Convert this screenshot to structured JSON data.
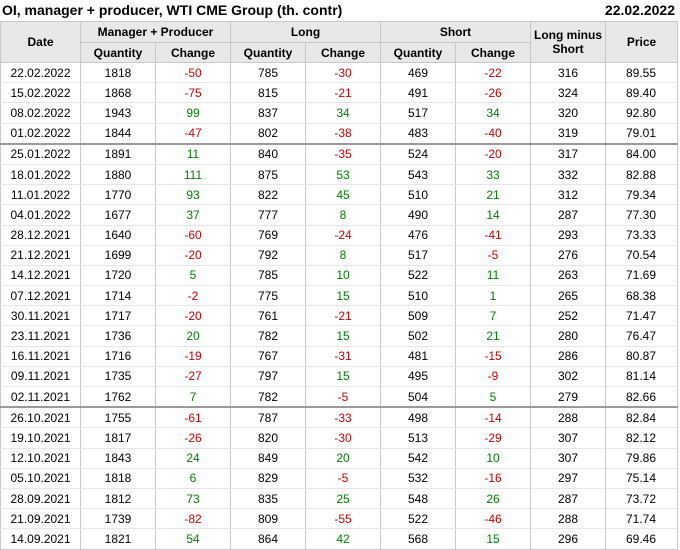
{
  "header": {
    "title": "OI, manager + producer, WTI CME Group (th. contr)",
    "date": "22.02.2022"
  },
  "columns": {
    "date": "Date",
    "manager_producer": "Manager + Producer",
    "long": "Long",
    "short": "Short",
    "long_minus_short_line1": "Long minus",
    "long_minus_short_line2": "Short",
    "price": "Price",
    "quantity": "Quantity",
    "change": "Change"
  },
  "colors": {
    "negative": "#cc0000",
    "positive": "#008000",
    "header_bg": "#e8e8e8"
  },
  "rows": [
    {
      "date": "22.02.2022",
      "mp_qty": "1818",
      "mp_chg": "-50",
      "long_qty": "785",
      "long_chg": "-30",
      "short_qty": "469",
      "short_chg": "-22",
      "lms": "316",
      "price": "89.55"
    },
    {
      "date": "15.02.2022",
      "mp_qty": "1868",
      "mp_chg": "-75",
      "long_qty": "815",
      "long_chg": "-21",
      "short_qty": "491",
      "short_chg": "-26",
      "lms": "324",
      "price": "89.40"
    },
    {
      "date": "08.02.2022",
      "mp_qty": "1943",
      "mp_chg": "99",
      "long_qty": "837",
      "long_chg": "34",
      "short_qty": "517",
      "short_chg": "34",
      "lms": "320",
      "price": "92.80"
    },
    {
      "date": "01.02.2022",
      "mp_qty": "1844",
      "mp_chg": "-47",
      "long_qty": "802",
      "long_chg": "-38",
      "short_qty": "483",
      "short_chg": "-40",
      "lms": "319",
      "price": "79.01"
    },
    {
      "date": "25.01.2022",
      "mp_qty": "1891",
      "mp_chg": "11",
      "long_qty": "840",
      "long_chg": "-35",
      "short_qty": "524",
      "short_chg": "-20",
      "lms": "317",
      "price": "84.00"
    },
    {
      "date": "18.01.2022",
      "mp_qty": "1880",
      "mp_chg": "111",
      "long_qty": "875",
      "long_chg": "53",
      "short_qty": "543",
      "short_chg": "33",
      "lms": "332",
      "price": "82.88"
    },
    {
      "date": "11.01.2022",
      "mp_qty": "1770",
      "mp_chg": "93",
      "long_qty": "822",
      "long_chg": "45",
      "short_qty": "510",
      "short_chg": "21",
      "lms": "312",
      "price": "79.34"
    },
    {
      "date": "04.01.2022",
      "mp_qty": "1677",
      "mp_chg": "37",
      "long_qty": "777",
      "long_chg": "8",
      "short_qty": "490",
      "short_chg": "14",
      "lms": "287",
      "price": "77.30"
    },
    {
      "date": "28.12.2021",
      "mp_qty": "1640",
      "mp_chg": "-60",
      "long_qty": "769",
      "long_chg": "-24",
      "short_qty": "476",
      "short_chg": "-41",
      "lms": "293",
      "price": "73.33"
    },
    {
      "date": "21.12.2021",
      "mp_qty": "1699",
      "mp_chg": "-20",
      "long_qty": "792",
      "long_chg": "8",
      "short_qty": "517",
      "short_chg": "-5",
      "lms": "276",
      "price": "70.54"
    },
    {
      "date": "14.12.2021",
      "mp_qty": "1720",
      "mp_chg": "5",
      "long_qty": "785",
      "long_chg": "10",
      "short_qty": "522",
      "short_chg": "11",
      "lms": "263",
      "price": "71.69"
    },
    {
      "date": "07.12.2021",
      "mp_qty": "1714",
      "mp_chg": "-2",
      "long_qty": "775",
      "long_chg": "15",
      "short_qty": "510",
      "short_chg": "1",
      "lms": "265",
      "price": "68.38"
    },
    {
      "date": "30.11.2021",
      "mp_qty": "1717",
      "mp_chg": "-20",
      "long_qty": "761",
      "long_chg": "-21",
      "short_qty": "509",
      "short_chg": "7",
      "lms": "252",
      "price": "71.47"
    },
    {
      "date": "23.11.2021",
      "mp_qty": "1736",
      "mp_chg": "20",
      "long_qty": "782",
      "long_chg": "15",
      "short_qty": "502",
      "short_chg": "21",
      "lms": "280",
      "price": "76.47"
    },
    {
      "date": "16.11.2021",
      "mp_qty": "1716",
      "mp_chg": "-19",
      "long_qty": "767",
      "long_chg": "-31",
      "short_qty": "481",
      "short_chg": "-15",
      "lms": "286",
      "price": "80.87"
    },
    {
      "date": "09.11.2021",
      "mp_qty": "1735",
      "mp_chg": "-27",
      "long_qty": "797",
      "long_chg": "15",
      "short_qty": "495",
      "short_chg": "-9",
      "lms": "302",
      "price": "81.14"
    },
    {
      "date": "02.11.2021",
      "mp_qty": "1762",
      "mp_chg": "7",
      "long_qty": "782",
      "long_chg": "-5",
      "short_qty": "504",
      "short_chg": "5",
      "lms": "279",
      "price": "82.66"
    },
    {
      "date": "26.10.2021",
      "mp_qty": "1755",
      "mp_chg": "-61",
      "long_qty": "787",
      "long_chg": "-33",
      "short_qty": "498",
      "short_chg": "-14",
      "lms": "288",
      "price": "82.84"
    },
    {
      "date": "19.10.2021",
      "mp_qty": "1817",
      "mp_chg": "-26",
      "long_qty": "820",
      "long_chg": "-30",
      "short_qty": "513",
      "short_chg": "-29",
      "lms": "307",
      "price": "82.12"
    },
    {
      "date": "12.10.2021",
      "mp_qty": "1843",
      "mp_chg": "24",
      "long_qty": "849",
      "long_chg": "20",
      "short_qty": "542",
      "short_chg": "10",
      "lms": "307",
      "price": "79.86"
    },
    {
      "date": "05.10.2021",
      "mp_qty": "1818",
      "mp_chg": "6",
      "long_qty": "829",
      "long_chg": "-5",
      "short_qty": "532",
      "short_chg": "-16",
      "lms": "297",
      "price": "75.14"
    },
    {
      "date": "28.09.2021",
      "mp_qty": "1812",
      "mp_chg": "73",
      "long_qty": "835",
      "long_chg": "25",
      "short_qty": "548",
      "short_chg": "26",
      "lms": "287",
      "price": "73.72"
    },
    {
      "date": "21.09.2021",
      "mp_qty": "1739",
      "mp_chg": "-82",
      "long_qty": "809",
      "long_chg": "-55",
      "short_qty": "522",
      "short_chg": "-46",
      "lms": "288",
      "price": "71.74"
    },
    {
      "date": "14.09.2021",
      "mp_qty": "1821",
      "mp_chg": "54",
      "long_qty": "864",
      "long_chg": "42",
      "short_qty": "568",
      "short_chg": "15",
      "lms": "296",
      "price": "69.46"
    }
  ]
}
